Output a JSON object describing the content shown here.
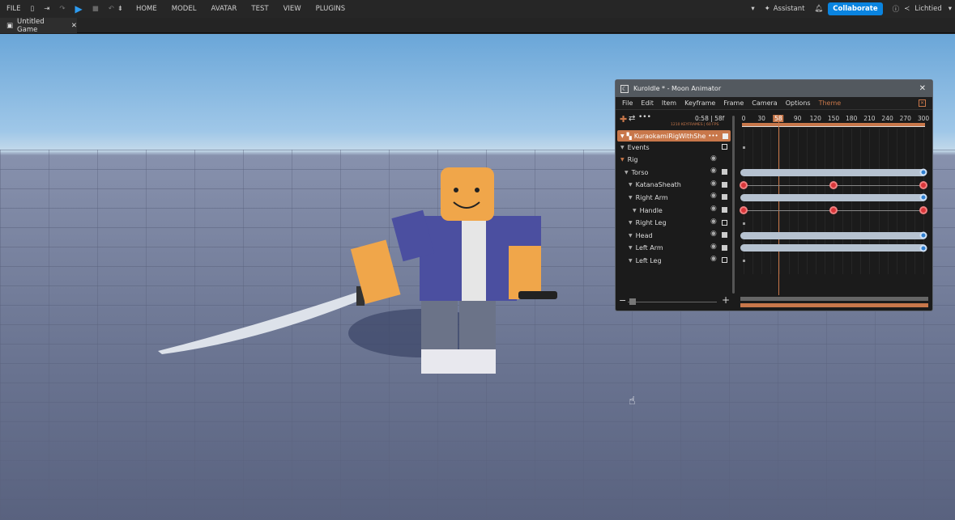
{
  "topbar": {
    "file": "FILE",
    "menus": [
      "HOME",
      "MODEL",
      "AVATAR",
      "TEST",
      "VIEW",
      "PLUGINS"
    ],
    "assistant": "Assistant",
    "collaborate": "Collaborate",
    "user": "Lichtied"
  },
  "tab": {
    "label": "Untitled Game"
  },
  "animator": {
    "title": "KuroIdle * - Moon Animator",
    "menu": [
      "File",
      "Edit",
      "Item",
      "Keyframe",
      "Frame",
      "Camera",
      "Options",
      "Theme"
    ],
    "time": "0:58 | 58f",
    "info": "1210 KEYFRAMES | 60 FPS",
    "current_frame": 58,
    "max_frame": 300,
    "ticks": [
      "0",
      "30",
      "58",
      "90",
      "120",
      "150",
      "180",
      "210",
      "240",
      "270",
      "300"
    ],
    "rig_name": "KuraokamiRigWithShe",
    "rows": [
      {
        "label": "Events",
        "indent": 0,
        "track": "dot"
      },
      {
        "label": "Rig",
        "indent": 0,
        "track": "none"
      },
      {
        "label": "Torso",
        "indent": 1,
        "track": "bar"
      },
      {
        "label": "KatanaSheath",
        "indent": 2,
        "track": "keys",
        "keys": [
          0,
          150,
          300
        ]
      },
      {
        "label": "Right Arm",
        "indent": 2,
        "track": "bar"
      },
      {
        "label": "Handle",
        "indent": 3,
        "track": "keys",
        "keys": [
          0,
          150,
          300
        ]
      },
      {
        "label": "Right Leg",
        "indent": 2,
        "track": "dot"
      },
      {
        "label": "Head",
        "indent": 2,
        "track": "bar"
      },
      {
        "label": "Left Arm",
        "indent": 2,
        "track": "bar"
      },
      {
        "label": "Left Leg",
        "indent": 2,
        "track": "dot"
      }
    ],
    "accent": "#c8774a"
  }
}
